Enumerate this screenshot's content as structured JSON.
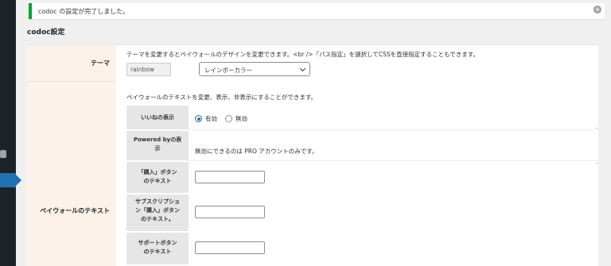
{
  "notice": {
    "text": "codoc の設定が完了しました。",
    "close_icon": "⊗"
  },
  "page_title": "codoc設定",
  "theme": {
    "label": "テーマ",
    "description": "テーマを変更するとペイウォールのデザインを変更できます。<br />「パス指定」を選択してCSSを直接指定することもできます。",
    "text_value": "rainbow",
    "select_value": "レインボーカラー"
  },
  "paywall": {
    "label": "ペイウォールのテキスト",
    "description": "ペイウォールのテキストを変更、表示、非表示にすることができます。",
    "rows": [
      {
        "label": "いいねの表示",
        "options": [
          {
            "label": "有効",
            "checked": true
          },
          {
            "label": "無効",
            "checked": false
          }
        ]
      },
      {
        "label": "Powered byの表示",
        "note": "無効にできるのは PRO アカウントのみです。"
      },
      {
        "label": "「購入」ボタンのテキスト",
        "value": ""
      },
      {
        "label": "サブスクリプション「購入」ボタンのテキスト。",
        "value": ""
      },
      {
        "label": "サポートボタンのテキスト",
        "value": ""
      }
    ]
  },
  "colors": {
    "accent": "#2271b1",
    "success": "#00a32a",
    "label_bg": "#fdf2e9"
  }
}
